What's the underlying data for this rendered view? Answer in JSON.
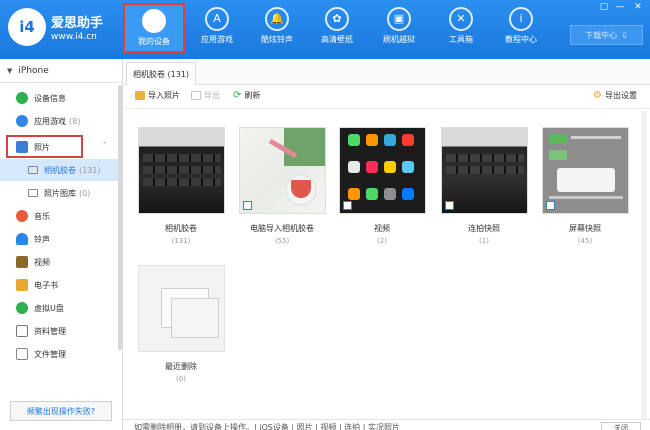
{
  "app": {
    "logo_mark": "i4",
    "name": "爱思助手",
    "url": "www.i4.cn"
  },
  "nav": [
    {
      "label": "我的设备",
      "icon": "apple-icon",
      "glyph": "",
      "active": true
    },
    {
      "label": "应用游戏",
      "icon": "app-store-icon",
      "glyph": "A"
    },
    {
      "label": "酷炫铃声",
      "icon": "bell-icon",
      "glyph": "🔔"
    },
    {
      "label": "高清壁纸",
      "icon": "flower-icon",
      "glyph": "✿"
    },
    {
      "label": "刷机越狱",
      "icon": "box-icon",
      "glyph": "▣"
    },
    {
      "label": "工具箱",
      "icon": "wrench-icon",
      "glyph": "✕"
    },
    {
      "label": "教程中心",
      "icon": "info-icon",
      "glyph": "i"
    }
  ],
  "window_controls": [
    "▢",
    "—",
    "✕"
  ],
  "download_button": {
    "label": "下载中心",
    "glyph": "⇩"
  },
  "sidebar": {
    "device": "iPhone",
    "items": [
      {
        "label": "设备信息",
        "icon": "info-icon",
        "color": "#2db04d"
      },
      {
        "label": "应用游戏",
        "count": "(8)",
        "icon": "app-icon",
        "color": "#2f86e6"
      },
      {
        "label": "照片",
        "icon": "photo-icon",
        "color": "#3a7ed8"
      },
      {
        "label": "相机胶卷",
        "count": "(131)",
        "icon": "album-icon"
      },
      {
        "label": "照片图库",
        "count": "(0)",
        "icon": "album-icon"
      },
      {
        "label": "音乐",
        "icon": "music-icon",
        "color": "#e85a3a"
      },
      {
        "label": "铃声",
        "icon": "bell-icon",
        "color": "#2a86e6"
      },
      {
        "label": "视频",
        "icon": "video-icon",
        "color": "#8a6a2a"
      },
      {
        "label": "电子书",
        "icon": "book-icon",
        "color": "#e8a830"
      },
      {
        "label": "虚拟U盘",
        "icon": "usb-icon",
        "color": "#2db04d"
      },
      {
        "label": "资料管理",
        "icon": "contacts-icon",
        "color": "#777777"
      },
      {
        "label": "文件管理",
        "icon": "file-icon",
        "color": "#888888"
      }
    ],
    "footer": "频繁出现操作失败?"
  },
  "main": {
    "tab": "相机胶卷 (131)",
    "toolbar": {
      "import": "导入照片",
      "export": "导出",
      "refresh": "刷新",
      "export_settings": "导出设置"
    },
    "albums": [
      {
        "name": "相机胶卷",
        "count": "(131)"
      },
      {
        "name": "电脑导入相机胶卷",
        "count": "(55)"
      },
      {
        "name": "视频",
        "count": "(2)"
      },
      {
        "name": "连拍快照",
        "count": "(1)"
      },
      {
        "name": "屏幕快照",
        "count": "(45)"
      },
      {
        "name": "最近删除",
        "count": "(0)"
      }
    ],
    "bottom": {
      "status": "如需删除相册，请到设备上操作。|   iOS设备   |   照片   |   视频   |   连拍   |   实况照片",
      "button": "关闭"
    }
  },
  "colors": {
    "accent": "#1a78dc",
    "highlight_border": "#d0453e",
    "selected_bg": "#d6e8fb"
  }
}
